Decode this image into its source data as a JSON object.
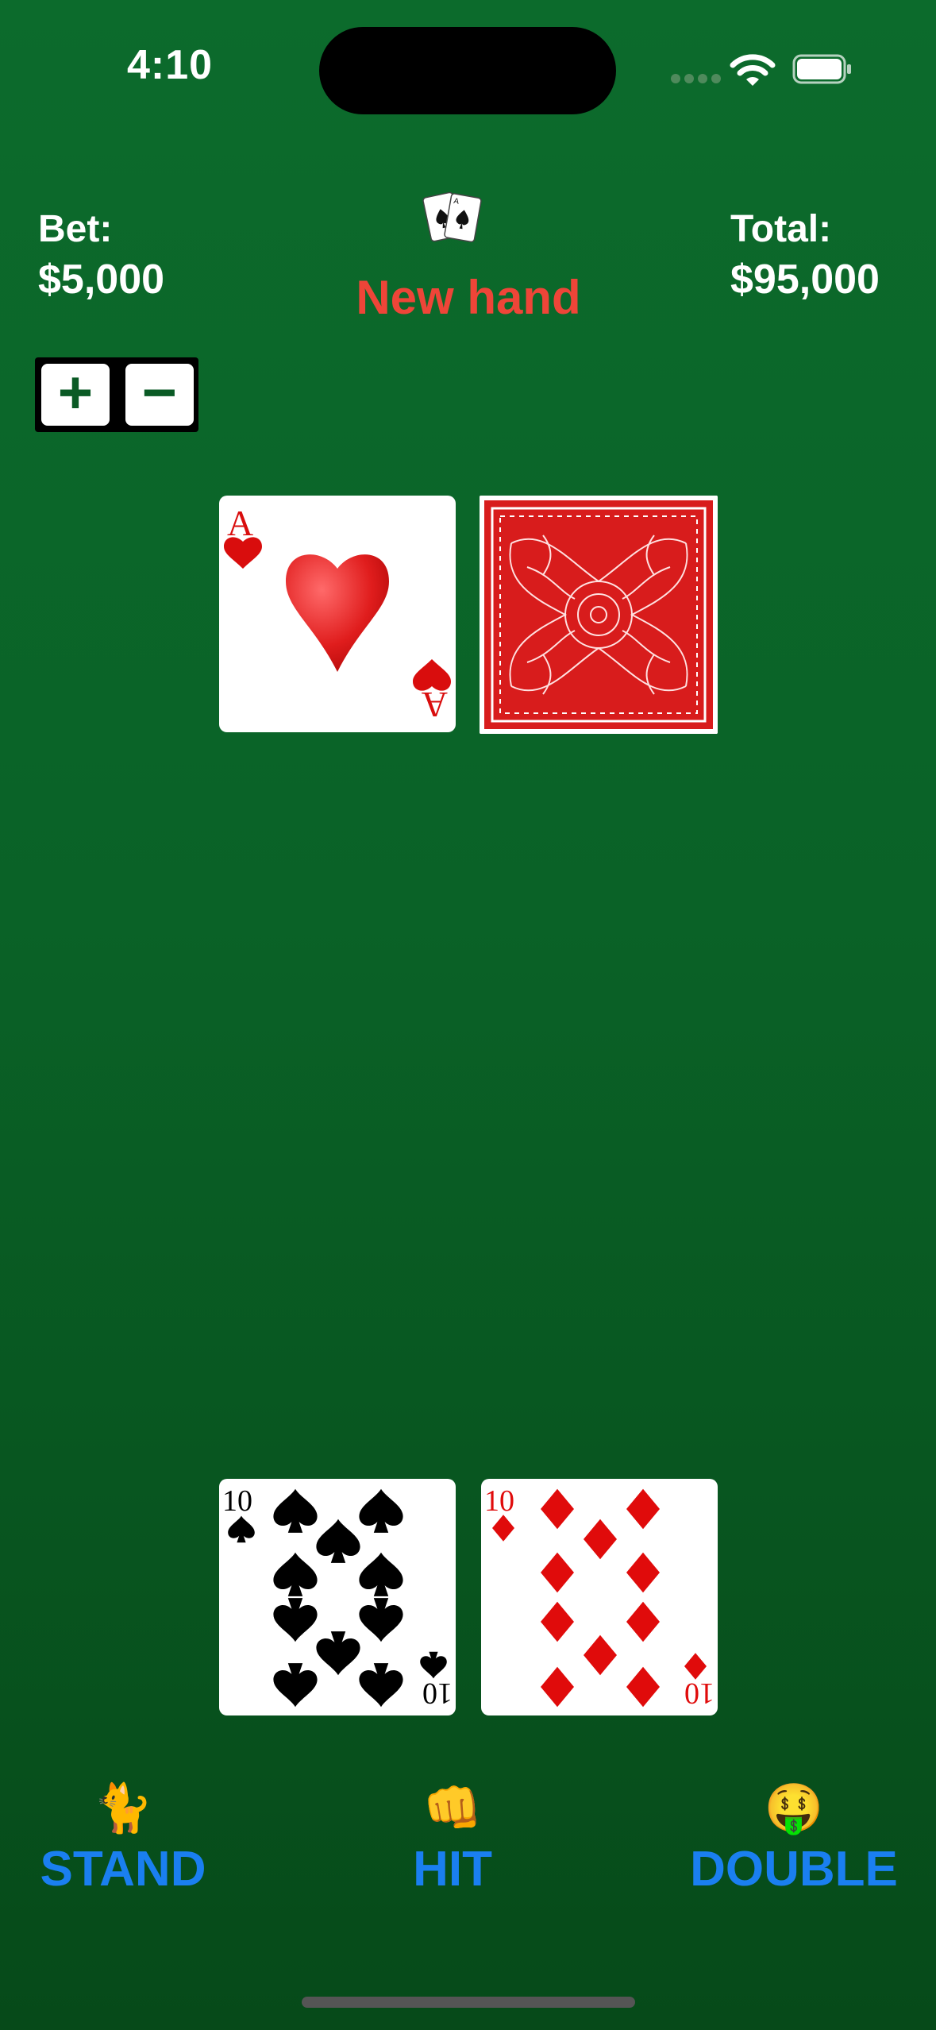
{
  "status_bar": {
    "time": "4:10"
  },
  "header": {
    "bet_label": "Bet:",
    "bet_value": "$5,000",
    "total_label": "Total:",
    "total_value": "$95,000",
    "status": "New hand",
    "status_color": "#ee4538"
  },
  "stepper": {
    "plus": "+",
    "minus": "−"
  },
  "dealer": {
    "cards": [
      {
        "rank": "A",
        "suit": "hearts",
        "face_up": true
      },
      {
        "rank": "",
        "suit": "",
        "face_up": false
      }
    ]
  },
  "player": {
    "cards": [
      {
        "rank": "10",
        "suit": "spades",
        "face_up": true
      },
      {
        "rank": "10",
        "suit": "diamonds",
        "face_up": true
      }
    ]
  },
  "actions": {
    "stand_label": "STAND",
    "stand_emoji": "🐈",
    "hit_label": "HIT",
    "hit_emoji": "👊",
    "double_label": "DOUBLE",
    "double_emoji": "🤑",
    "accent_color": "#1a7ff0"
  }
}
